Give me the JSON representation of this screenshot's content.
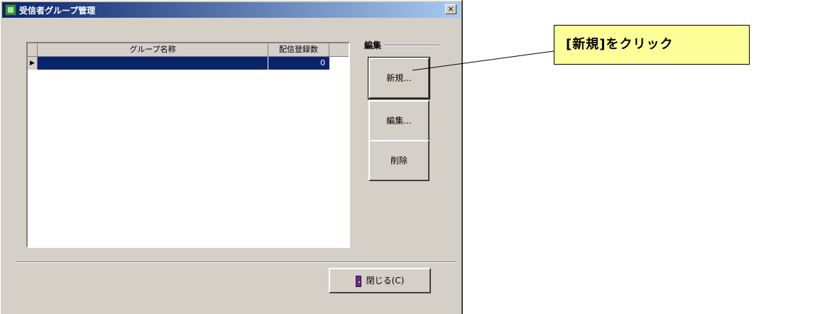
{
  "window": {
    "title": "受信者グループ管理",
    "close_glyph": "×"
  },
  "grid": {
    "columns": [
      "",
      "グループ名称",
      "配信登録数"
    ],
    "rows": [
      {
        "indicator": "▶",
        "name": "",
        "count": "0",
        "selected": true
      }
    ]
  },
  "edit_group": {
    "label": "編集",
    "buttons": {
      "new": "新規...",
      "edit": "編集...",
      "delete": "削除"
    }
  },
  "footer": {
    "close_label": "閉じる(C)",
    "close_icon": "door-icon"
  },
  "annotation": {
    "text": "[新規]をクリック",
    "background": "#ffff99"
  },
  "colors": {
    "title_gradient_start": "#0a246a",
    "title_gradient_end": "#a6caf0",
    "selection": "#0a246a",
    "dialog_face": "#d4d0c8"
  }
}
